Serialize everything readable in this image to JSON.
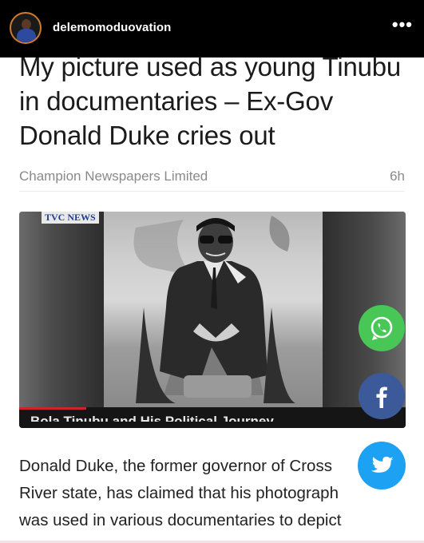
{
  "post_header": {
    "username": "delemomoduovation",
    "more_label": "•••",
    "avatar_icon": "profile-avatar"
  },
  "article": {
    "headline": "My picture used as young Tinubu in documentaries – Ex-Gov Donald Duke cries out",
    "source": "Champion Newspapers Limited",
    "time": "6h",
    "image": {
      "channel_logo": "TVC NEWS",
      "caption": "Bola Tinubu and His Political Journey"
    },
    "body_lines": [
      "Donald Duke, the former governor of Cross",
      "River state, has claimed that his photograph",
      "was used in various documentaries to depict"
    ]
  },
  "share_buttons": [
    {
      "name": "whatsapp",
      "icon": "whatsapp-icon",
      "color": "#48c757"
    },
    {
      "name": "facebook",
      "icon": "facebook-icon",
      "color": "#3c5a99"
    },
    {
      "name": "twitter",
      "icon": "twitter-icon",
      "color": "#1da1f2"
    }
  ]
}
